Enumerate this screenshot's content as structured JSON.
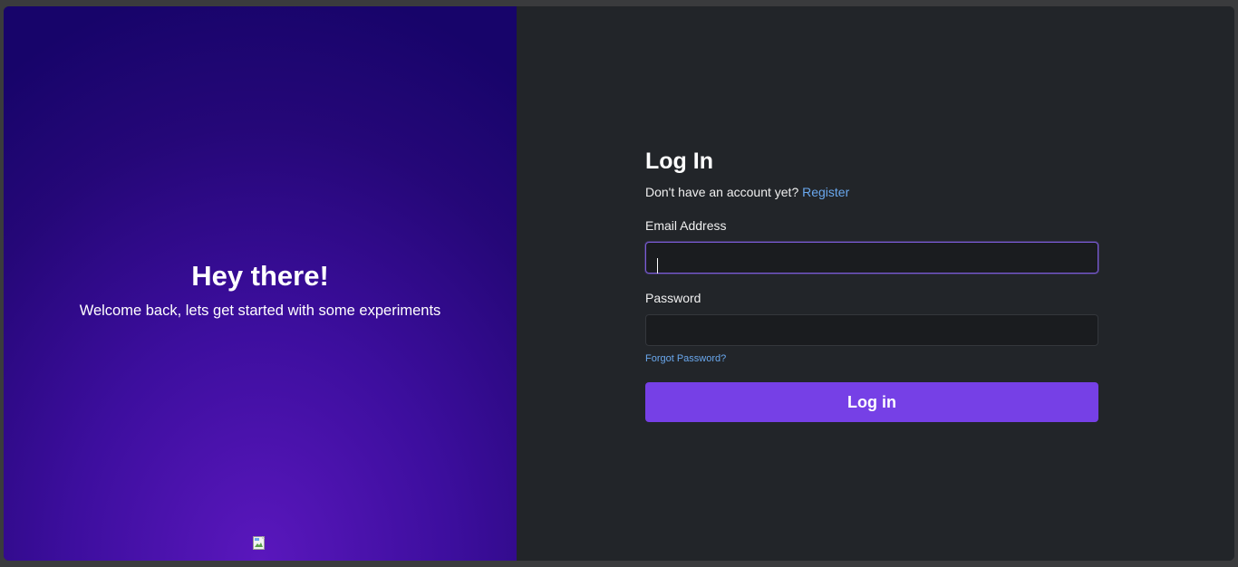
{
  "colors": {
    "accent": "#7640e6",
    "link": "#6aa8ee",
    "panel_bg": "#222529",
    "input_bg": "#1a1c1f"
  },
  "hero": {
    "title": "Hey there!",
    "subtitle": "Welcome back, lets get started with some experiments",
    "image_icon": "broken-image-icon"
  },
  "login": {
    "title": "Log In",
    "register_prompt": "Don't have an account yet?",
    "register_link": "Register",
    "email_label": "Email Address",
    "email_value": "",
    "password_label": "Password",
    "password_value": "",
    "forgot_password": "Forgot Password?",
    "submit_label": "Log in"
  }
}
